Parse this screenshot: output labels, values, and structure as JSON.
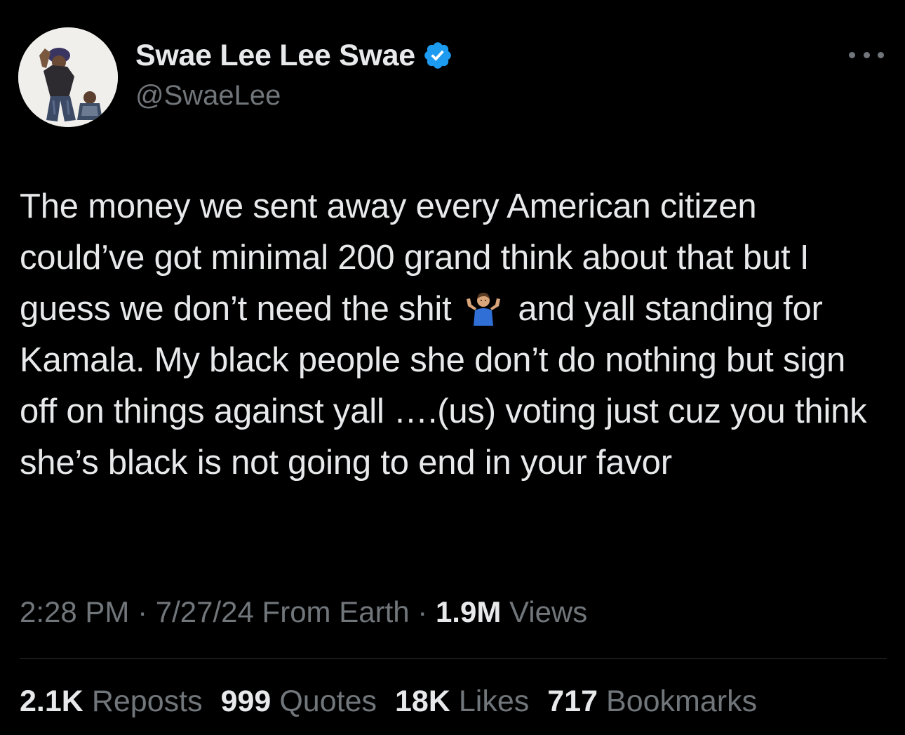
{
  "author": {
    "display_name": "Swae Lee Lee Swae",
    "handle": "@SwaeLee",
    "verified": true,
    "verified_color": "#1d9bf0"
  },
  "tweet": {
    "text_before_emoji": "The money we sent away every American citizen could’ve got minimal 200 grand think about that but I guess we don’t need the shit",
    "emoji": "shrug-icon",
    "text_after_emoji": "and yall standing for Kamala. My black people she don’t do nothing but sign off on things against yall ….(us) voting just cuz you think she’s black is not going to end in your favor"
  },
  "meta": {
    "time": "2:28 PM",
    "sep1": " · ",
    "date": "7/27/24",
    "source": " From Earth",
    "sep2": " · ",
    "views_count": "1.9M",
    "views_label": " Views"
  },
  "stats": {
    "reposts_count": "2.1K",
    "reposts_label": "Reposts",
    "quotes_count": "999",
    "quotes_label": "Quotes",
    "likes_count": "18K",
    "likes_label": "Likes",
    "bookmarks_count": "717",
    "bookmarks_label": "Bookmarks"
  },
  "colors": {
    "background": "#000000",
    "text_primary": "#e7e9ea",
    "text_secondary": "#71767b",
    "divider": "#2f3336"
  }
}
